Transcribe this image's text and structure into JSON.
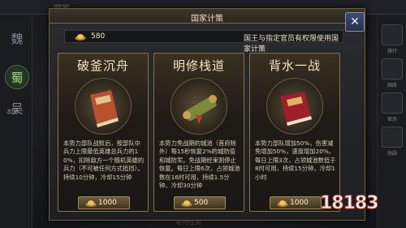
{
  "background": {
    "title": "国家",
    "kingdoms": [
      "魏",
      "蜀",
      "吴"
    ],
    "kingdom_sub": "本国",
    "right_rail_labels": [
      "排行",
      "国库",
      "官员",
      "功勋"
    ],
    "bottom_hint": "等待任务"
  },
  "dialog": {
    "title": "国家计策",
    "close_glyph": "✕",
    "gold_amount": "580",
    "note": "国王与指定官员有权限使用国家计策"
  },
  "cards": [
    {
      "title": "破釜沉舟",
      "art_icon": "red-book-icon",
      "desc": "本势力部队战败后，按部队中兵力上限最低英雄总兵力的10%，扣除敌方一个随机英雄的兵力（不可被任何方式抵挡）。持续10分钟，冷却15分钟",
      "cost": "1000"
    },
    {
      "title": "明修栈道",
      "art_icon": "scroll-icon",
      "desc": "本势力免战期的城池（首府除外）每15秒恢复2%的城防值和城防军。免战期经束则停止恢复。每日上限6次，占领城池数在16时可用，持续1.5分钟，冷却30分钟",
      "cost": "500"
    },
    {
      "title": "背水一战",
      "art_icon": "red-book-icon",
      "desc": "本势力部队增加50%，伤害减免增加50%，速度增加20%。每日上限3次，占领城池数低于8时可用，持续15分钟，冷却1小时",
      "cost": "1000"
    }
  ],
  "watermark": "18183"
}
